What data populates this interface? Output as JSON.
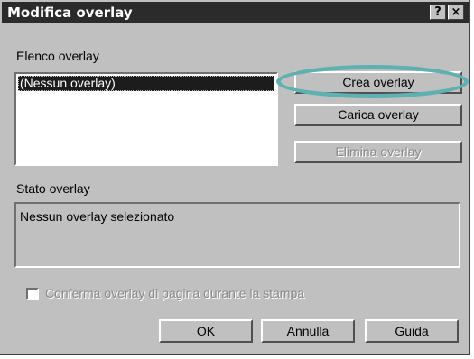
{
  "window": {
    "title": "Modifica overlay",
    "help_label": "?",
    "close_label": "×"
  },
  "overlay_list": {
    "label": "Elenco overlay",
    "items": [
      "(Nessun overlay)"
    ]
  },
  "buttons": {
    "create": "Crea overlay",
    "load": "Carica overlay",
    "delete": "Elimina overlay",
    "ok": "OK",
    "cancel": "Annulla",
    "help": "Guida"
  },
  "status": {
    "label": "Stato overlay",
    "text": "Nessun overlay selezionato"
  },
  "confirm_checkbox": {
    "label": "Conferma overlay di pagina durante la stampa",
    "checked": false,
    "enabled": false
  },
  "colors": {
    "highlight_ring": "#5fb0b0",
    "titlebar": "#2b2b2b",
    "face": "#c0c0c0"
  }
}
